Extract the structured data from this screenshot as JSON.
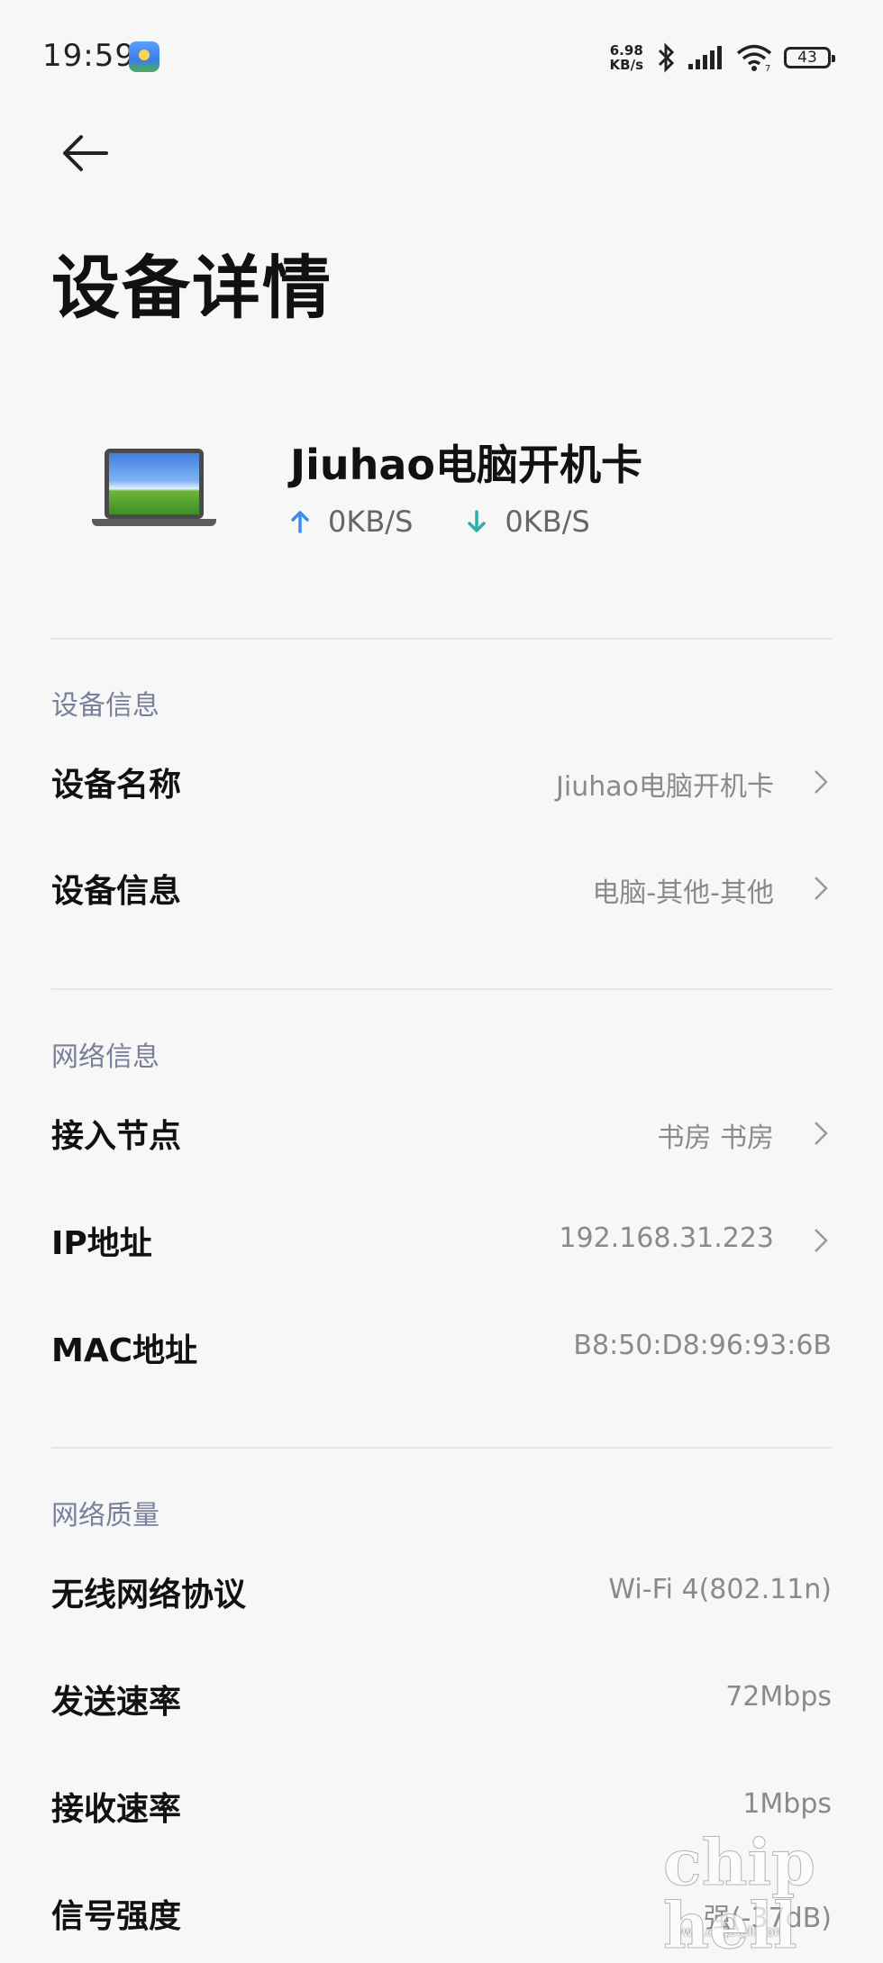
{
  "status_bar": {
    "time": "19:59",
    "net_speed_value": "6.98",
    "net_speed_unit": "KB/s",
    "battery": "43",
    "wifi_badge": "7"
  },
  "page": {
    "title": "设备详情"
  },
  "device": {
    "name": "Jiuhao电脑开机卡",
    "upload_speed": "0KB/S",
    "download_speed": "0KB/S",
    "upload_color": "#3b8bf0",
    "download_color": "#2bb0a6"
  },
  "sections": {
    "device_info": {
      "title": "设备信息",
      "rows": [
        {
          "label": "设备名称",
          "value": "Jiuhao电脑开机卡"
        },
        {
          "label": "设备信息",
          "value": "电脑-其他-其他"
        }
      ]
    },
    "network_info": {
      "title": "网络信息",
      "rows": [
        {
          "label": "接入节点",
          "value": "书房 书房"
        },
        {
          "label": "IP地址",
          "value": "192.168.31.223"
        },
        {
          "label": "MAC地址",
          "value": "B8:50:D8:96:93:6B"
        }
      ]
    },
    "network_quality": {
      "title": "网络质量",
      "rows": [
        {
          "label": "无线网络协议",
          "value": "Wi-Fi 4(802.11n)"
        },
        {
          "label": "发送速率",
          "value": "72Mbps"
        },
        {
          "label": "接收速率",
          "value": "1Mbps"
        },
        {
          "label": "信号强度",
          "value": "强(-37dB)"
        }
      ]
    }
  },
  "watermark": {
    "url": "www.chiphell.com",
    "logo": "chip hell"
  }
}
